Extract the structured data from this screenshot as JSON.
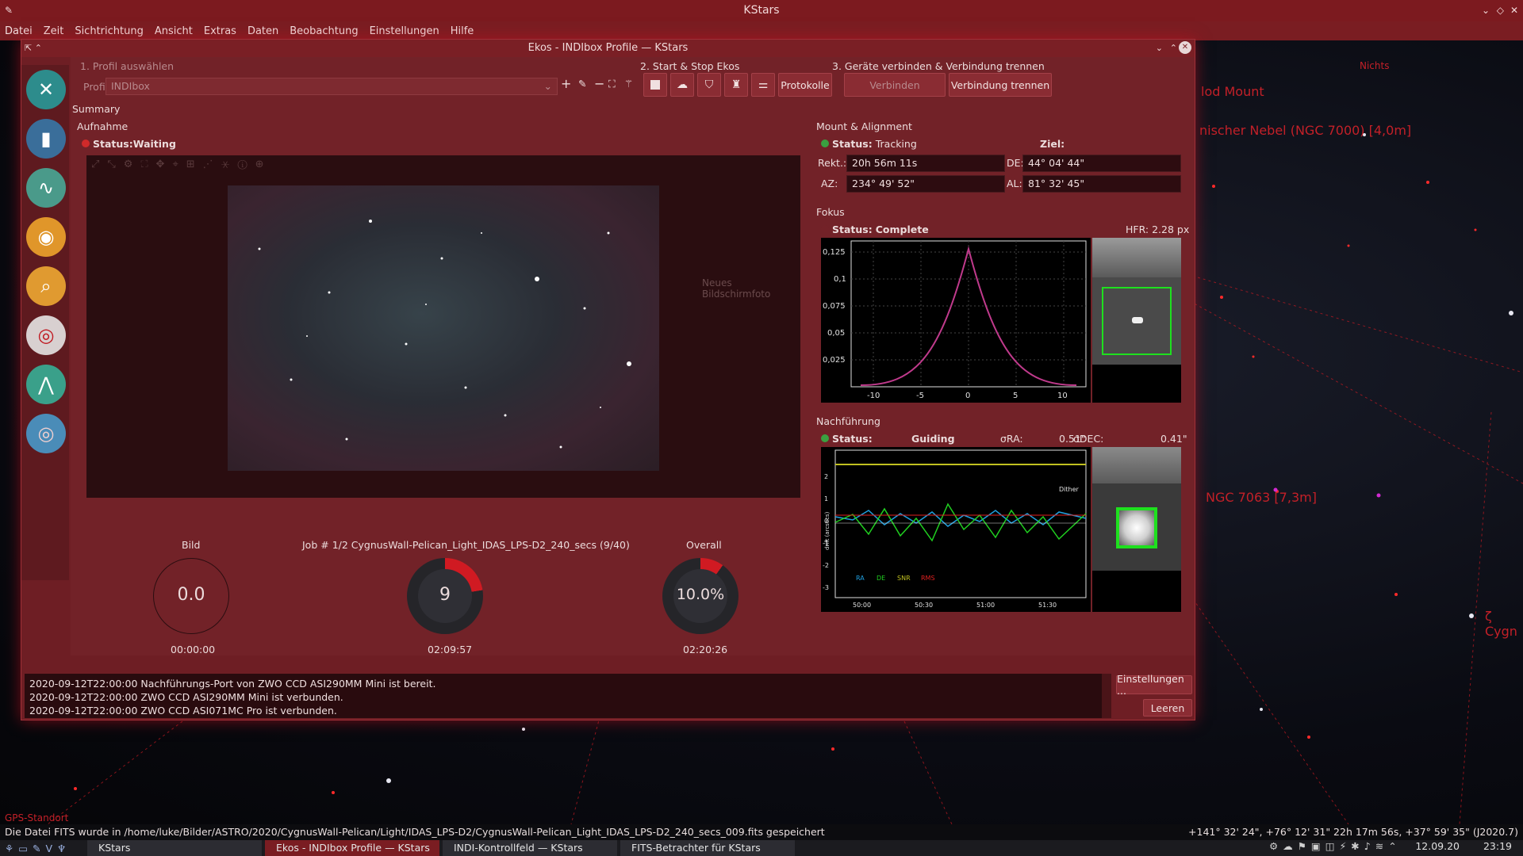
{
  "kstars": {
    "title": "KStars",
    "menu": [
      "Datei",
      "Zeit",
      "Sichtrichtung",
      "Ansicht",
      "Extras",
      "Daten",
      "Beobachtung",
      "Einstellungen",
      "Hilfe"
    ]
  },
  "sky": {
    "labels": [
      "Nichts",
      "lod Mount",
      "nischer Nebel (NGC 7000) [4,0m]",
      "NGC 7063 [7,3m]",
      "ζ Cygn",
      "GPS-Standort"
    ]
  },
  "ekos": {
    "title": "Ekos - INDIbox Profile — KStars",
    "step1": "1. Profil auswählen",
    "profile_label": "Profil:",
    "profile_value": "INDIbox",
    "step2": "2. Start & Stop Ekos",
    "protokolle": "Protokolle",
    "step3": "3. Geräte verbinden & Verbindung trennen",
    "connect": "Verbinden",
    "disconnect": "Verbindung trennen",
    "summary": "Summary",
    "capture": {
      "heading": "Aufnahme",
      "status_label": "Status:",
      "status": "Waiting",
      "overlay": "Neues Bildschirmfoto",
      "bild": "Bild",
      "bild_value": "0.0",
      "bild_time": "00:00:00",
      "job": "Job # 1/2 CygnusWall-Pelican_Light_IDAS_LPS-D2_240_secs (9/40)",
      "job_value": "9",
      "job_progress": 0.225,
      "job_time": "02:09:57",
      "overall": "Overall",
      "overall_value": "10.0%",
      "overall_progress": 0.1,
      "overall_time": "02:20:26"
    },
    "mount": {
      "heading": "Mount & Alignment",
      "status_label": "Status:",
      "status": "Tracking",
      "target": "Ziel:",
      "ra_label": "Rekt.:",
      "ra": "20h 56m 11s",
      "de_label": "DE:",
      "de": "44° 04' 44\"",
      "az_label": "AZ:",
      "az": "234° 49' 52\"",
      "al_label": "AL:",
      "al": "81° 32' 45\""
    },
    "focus": {
      "heading": "Fokus",
      "status_label": "Status:",
      "status": "Complete",
      "hfr": "HFR: 2.28 px",
      "y_ticks": [
        "0,125",
        "0,1",
        "0,075",
        "0,05",
        "0,025"
      ],
      "x_ticks": [
        "-10",
        "-5",
        "0",
        "5",
        "10"
      ]
    },
    "guide": {
      "heading": "Nachführung",
      "status_label": "Status:",
      "status": "Guiding",
      "rms_ra_label": "σRA:",
      "rms_ra": "0.51\"",
      "rms_dec_label": "σDEC:",
      "rms_dec": "0.41\"",
      "dither": "Dither",
      "legend": [
        "RA",
        "DE",
        "SNR",
        "RMS"
      ],
      "x_ticks": [
        "50:00",
        "50:30",
        "51:00",
        "51:30"
      ],
      "y_ticks": [
        "2",
        "1",
        "0",
        "-1",
        "-2",
        "-3"
      ],
      "y_label": "drift (arcsecs)"
    },
    "log": [
      "2020-09-12T22:00:00 Nachführungs-Port von ZWO CCD ASI290MM Mini ist bereit.",
      "2020-09-12T22:00:00 ZWO CCD ASI290MM Mini ist verbunden.",
      "2020-09-12T22:00:00 ZWO CCD ASI071MC Pro ist verbunden."
    ],
    "settings_btn": "Einstellungen ...",
    "clear_btn": "Leeren"
  },
  "statusbar": {
    "message": "Die Datei FITS wurde in /home/luke/Bilder/ASTRO/2020/CygnusWall-Pelican/Light/IDAS_LPS-D2/CygnusWall-Pelican_Light_IDAS_LPS-D2_240_secs_009.fits gespeichert",
    "coords": "+141° 32' 24\", +76° 12' 31\"  22h 17m 56s, +37° 59' 35\" (J2020.7)"
  },
  "taskbar": {
    "tasks": [
      "KStars",
      "Ekos - INDIbox Profile — KStars",
      "INDI-Kontrollfeld — KStars",
      "FITS-Betrachter für KStars"
    ],
    "date": "12.09.20",
    "time": "23:19"
  },
  "colors": {
    "accent": "#7a1d22",
    "window": "#722228",
    "ring": "#d01a22"
  }
}
